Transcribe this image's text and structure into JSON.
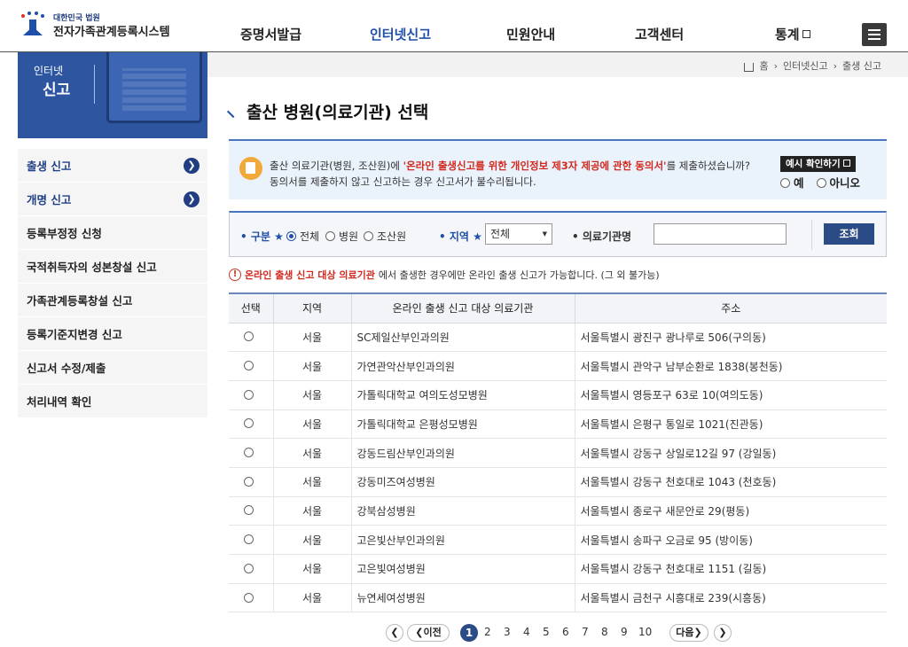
{
  "logo": {
    "small": "대한민국 법원",
    "big": "전자가족관계등록시스템"
  },
  "gnb": [
    {
      "label": "증명서발급"
    },
    {
      "label": "인터넷신고"
    },
    {
      "label": "민원안내"
    },
    {
      "label": "고객센터"
    },
    {
      "label": "통계"
    }
  ],
  "banner": {
    "line1": "인터넷",
    "line2": "신고"
  },
  "lnb": [
    {
      "label": "출생 신고"
    },
    {
      "label": "개명 신고"
    },
    {
      "label": "등록부정정 신청"
    },
    {
      "label": "국적취득자의 성본창설 신고"
    },
    {
      "label": "가족관계등록창설 신고"
    },
    {
      "label": "등록기준지변경 신고"
    },
    {
      "label": "신고서 수정/제출"
    },
    {
      "label": "처리내역 확인"
    }
  ],
  "breadcrumb": {
    "home": "홈",
    "level1": "인터넷신고",
    "level2": "출생 신고"
  },
  "page_title": "출산 병원(의료기관) 선택",
  "notice": {
    "pre": "출산 의료기관(병원, 조산원)에 ",
    "highlight": "'온라인 출생신고를 위한 개인정보 제3자 제공에 관한 동의서'",
    "post": "를 제출하셨습니까?",
    "line2": "동의서를 제출하지 않고 신고하는 경우 신고서가 불수리됩니다.",
    "example_button": "예시 확인하기",
    "yes": "예",
    "no": "아니오"
  },
  "search": {
    "type_label": "구분",
    "type_options": [
      "전체",
      "병원",
      "조산원"
    ],
    "type_selected": "전체",
    "region_label": "지역",
    "region_value": "전체",
    "institution_label": "의료기관명",
    "institution_value": "",
    "search_button": "조회"
  },
  "info": {
    "highlight": "온라인 출생 신고 대상 의료기관",
    "rest": "에서 출생한 경우에만 온라인 출생 신고가 가능합니다. (그 외 불가능)"
  },
  "table": {
    "headers": [
      "선택",
      "지역",
      "온라인 출생 신고 대상 의료기관",
      "주소"
    ],
    "rows": [
      {
        "region": "서울",
        "name": "SC제일산부인과의원",
        "address": "서울특별시 광진구 광나루로 506(구의동)"
      },
      {
        "region": "서울",
        "name": "가연관악산부인과의원",
        "address": "서울특별시 관악구 남부순환로 1838(봉천동)"
      },
      {
        "region": "서울",
        "name": "가톨릭대학교 여의도성모병원",
        "address": "서울특별시 영등포구 63로 10(여의도동)"
      },
      {
        "region": "서울",
        "name": "가톨릭대학교 은평성모병원",
        "address": "서울특별시 은평구 통일로 1021(진관동)"
      },
      {
        "region": "서울",
        "name": "강동드림산부인과의원",
        "address": "서울특별시 강동구 상일로12길 97 (강일동)"
      },
      {
        "region": "서울",
        "name": "강동미즈여성병원",
        "address": "서울특별시 강동구 천호대로 1043 (천호동)"
      },
      {
        "region": "서울",
        "name": "강북삼성병원",
        "address": "서울특별시 종로구 새문안로 29(평동)"
      },
      {
        "region": "서울",
        "name": "고은빛산부인과의원",
        "address": "서울특별시 송파구 오금로 95 (방이동)"
      },
      {
        "region": "서울",
        "name": "고은빛여성병원",
        "address": "서울특별시 강동구 천호대로 1151 (길동)"
      },
      {
        "region": "서울",
        "name": "뉴연세여성병원",
        "address": "서울특별시 금천구 시흥대로 239(시흥동)"
      }
    ]
  },
  "pagination": {
    "prev": "이전",
    "next": "다음",
    "current": "1",
    "pages": [
      "2",
      "3",
      "4",
      "5",
      "6",
      "7",
      "8",
      "9",
      "10"
    ]
  },
  "colors": {
    "primary": "#2b4b87",
    "accent": "#1f4fa8",
    "highlight": "#d22a1f",
    "banner": "#2d55a0"
  }
}
